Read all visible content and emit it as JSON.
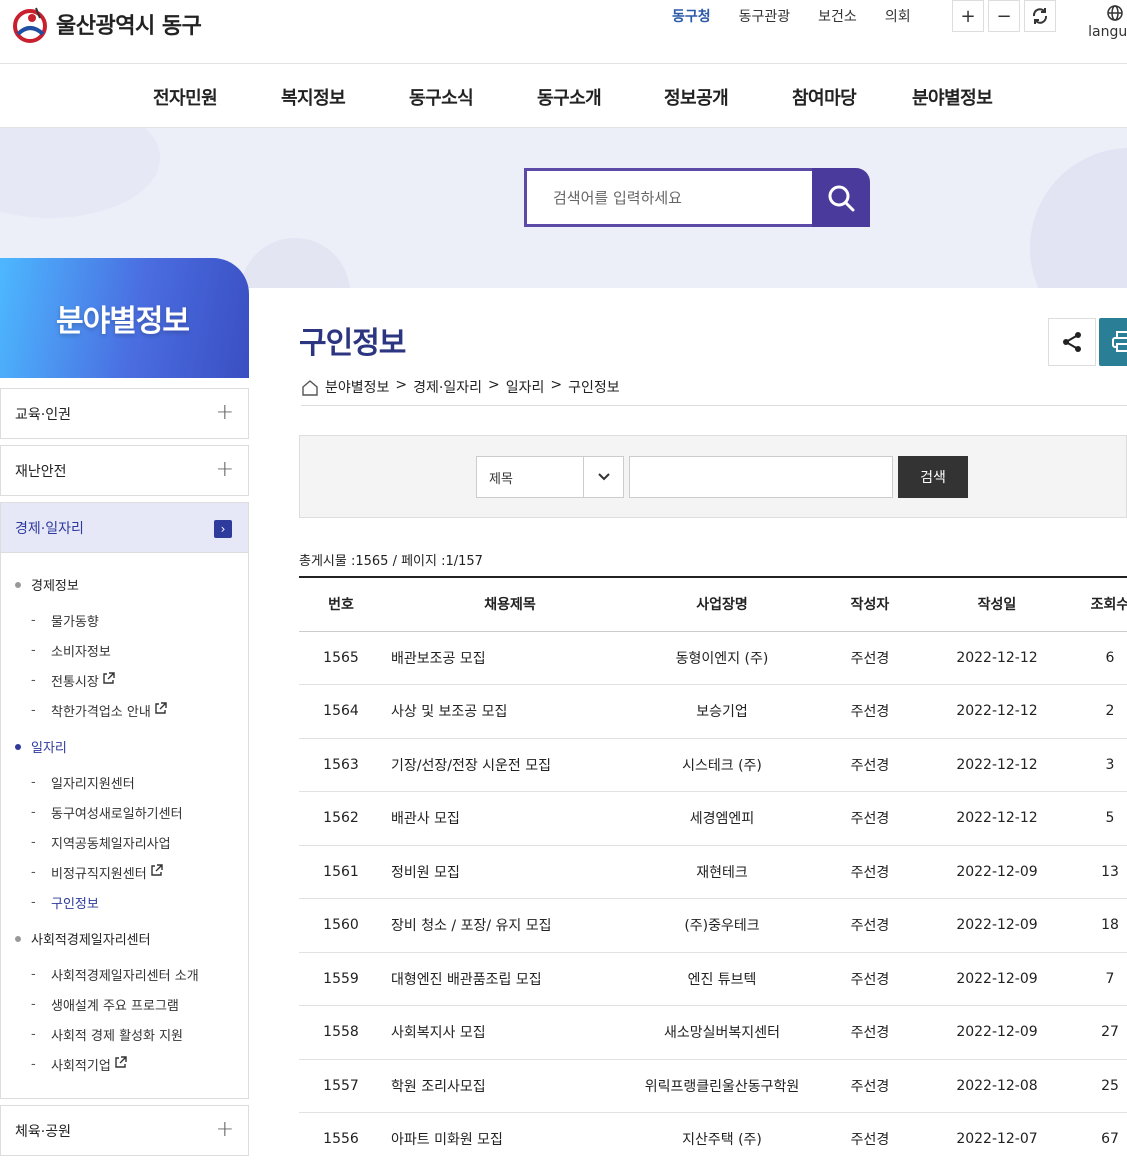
{
  "header": {
    "logo_text": "울산광역시 동구",
    "util_links": [
      {
        "label": "동구청",
        "active": true
      },
      {
        "label": "동구관광",
        "active": false
      },
      {
        "label": "보건소",
        "active": false
      },
      {
        "label": "의회",
        "active": false
      }
    ],
    "zoom_in": "+",
    "zoom_out": "−",
    "language": "langua"
  },
  "gnb": [
    "전자민원",
    "복지정보",
    "동구소식",
    "동구소개",
    "정보공개",
    "참여마당",
    "분야별정보"
  ],
  "search": {
    "placeholder": "검색어를 입력하세요"
  },
  "sidebar": {
    "title": "분야별정보",
    "menus_top": [
      {
        "label": "교육·인권",
        "icon": "plus-icon"
      },
      {
        "label": "재난안전",
        "icon": "plus-icon"
      },
      {
        "label": "경제·일자리",
        "icon": "chevron-right-icon",
        "active": true
      }
    ],
    "sub": [
      {
        "level": 1,
        "label": "경제정보"
      },
      {
        "level": 2,
        "label": "물가동향"
      },
      {
        "level": 2,
        "label": "소비자정보"
      },
      {
        "level": 2,
        "label": "전통시장",
        "external": true
      },
      {
        "level": 2,
        "label": "착한가격업소 안내",
        "external": true
      },
      {
        "level": 1,
        "label": "일자리",
        "active": true
      },
      {
        "level": 2,
        "label": "일자리지원센터"
      },
      {
        "level": 2,
        "label": "동구여성새로일하기센터"
      },
      {
        "level": 2,
        "label": "지역공동체일자리사업"
      },
      {
        "level": 2,
        "label": "비정규직지원센터",
        "external": true
      },
      {
        "level": 2,
        "label": "구인정보",
        "active": true
      },
      {
        "level": 1,
        "label": "사회적경제일자리센터"
      },
      {
        "level": 2,
        "label": "사회적경제일자리센터 소개"
      },
      {
        "level": 2,
        "label": "생애설계 주요 프로그램"
      },
      {
        "level": 2,
        "label": "사회적 경제 활성화 지원"
      },
      {
        "level": 2,
        "label": "사회적기업",
        "external": true
      }
    ],
    "menus_bottom": [
      {
        "label": "체육·공원",
        "icon": "plus-icon"
      }
    ]
  },
  "content": {
    "title": "구인정보",
    "breadcrumb": [
      "분야별정보",
      ">",
      "경제·일자리",
      ">",
      "일자리",
      ">",
      "구인정보"
    ],
    "filter": {
      "select_value": "제목",
      "button": "검색"
    },
    "board_info": "총게시물 :1565 / 페이지 :1/157",
    "table": {
      "headers": [
        "번호",
        "채용제목",
        "사업장명",
        "작성자",
        "작성일",
        "조회수"
      ],
      "rows": [
        [
          "1565",
          "배관보조공 모집",
          "동형이엔지 (주)",
          "주선경",
          "2022-12-12",
          "6"
        ],
        [
          "1564",
          "사상 및 보조공 모집",
          "보승기업",
          "주선경",
          "2022-12-12",
          "2"
        ],
        [
          "1563",
          "기장/선장/전장 시운전 모집",
          "시스테크 (주)",
          "주선경",
          "2022-12-12",
          "3"
        ],
        [
          "1562",
          "배관사 모집",
          "세경엠엔피",
          "주선경",
          "2022-12-12",
          "5"
        ],
        [
          "1561",
          "정비원 모집",
          "재현테크",
          "주선경",
          "2022-12-09",
          "13"
        ],
        [
          "1560",
          "장비 청소 / 포장/ 유지 모집",
          "(주)중우테크",
          "주선경",
          "2022-12-09",
          "18"
        ],
        [
          "1559",
          "대형엔진 배관품조립 모집",
          "엔진 튜브텍",
          "주선경",
          "2022-12-09",
          "7"
        ],
        [
          "1558",
          "사회복지사 모집",
          "새소망실버복지센터",
          "주선경",
          "2022-12-09",
          "27"
        ],
        [
          "1557",
          "학원 조리사모집",
          "위릭프랭클린울산동구학원",
          "주선경",
          "2022-12-08",
          "25"
        ],
        [
          "1556",
          "아파트 미화원 모집",
          "지산주택 (주)",
          "주선경",
          "2022-12-07",
          "67"
        ]
      ]
    }
  }
}
